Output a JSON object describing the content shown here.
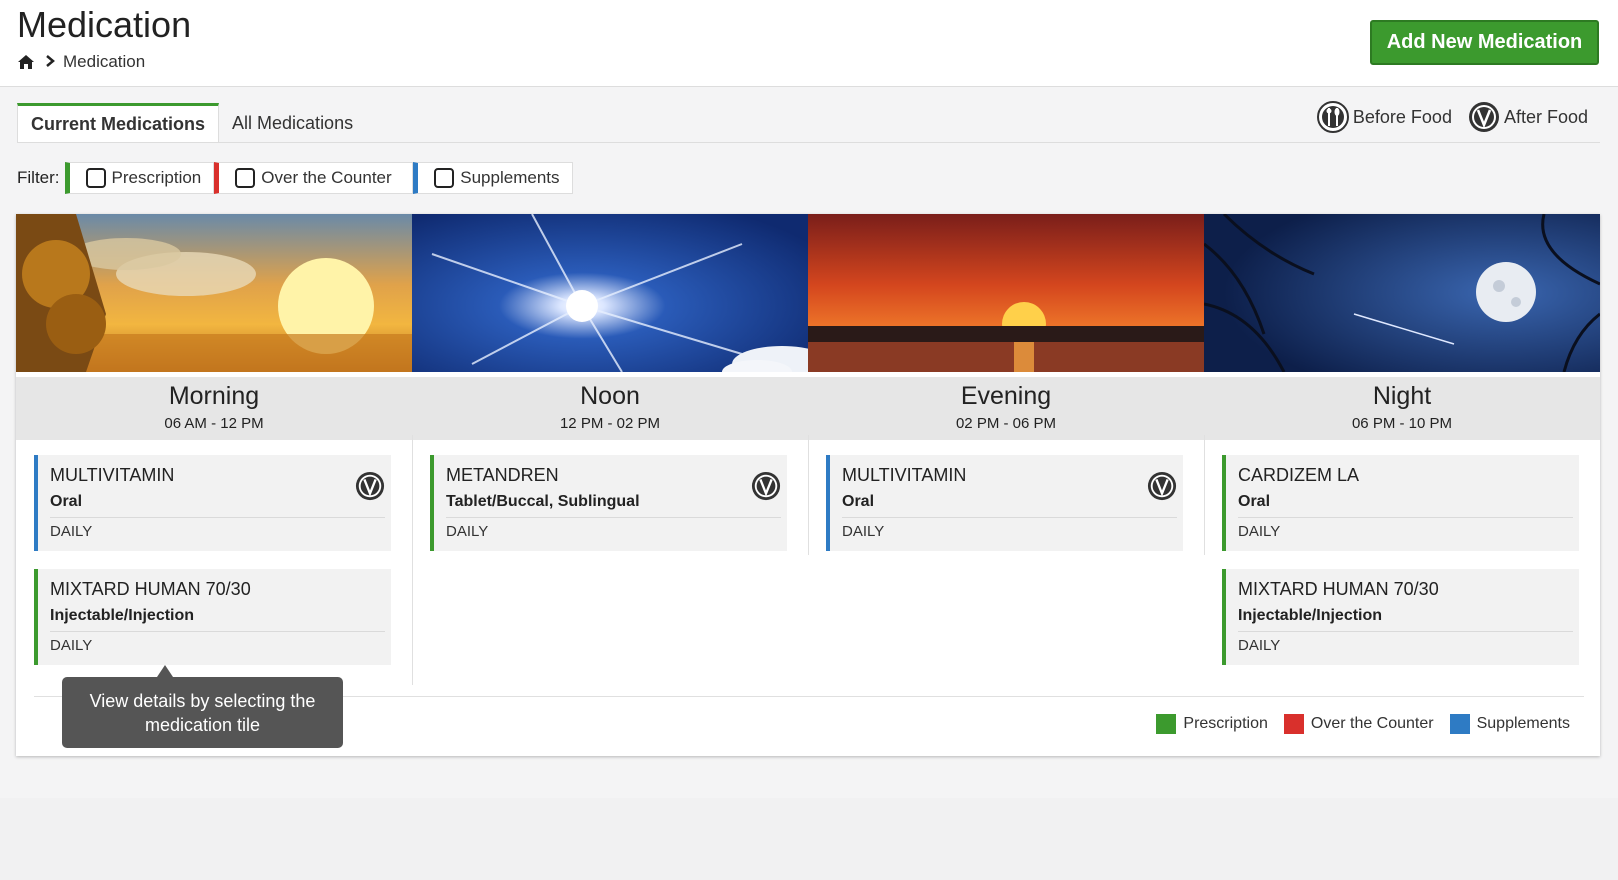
{
  "header": {
    "title": "Medication",
    "breadcrumb_current": "Medication",
    "add_button": "Add New Medication"
  },
  "tabs": [
    {
      "label": "Current Medications",
      "active": true
    },
    {
      "label": "All Medications",
      "active": false
    }
  ],
  "food_legend": {
    "before": "Before Food",
    "after": "After Food"
  },
  "filter": {
    "label": "Filter:",
    "options": [
      {
        "label": "Prescription",
        "color": "#3c9a2e",
        "checked": false
      },
      {
        "label": "Over the Counter",
        "color": "#d9302c",
        "checked": false
      },
      {
        "label": "Supplements",
        "color": "#2e7bc4",
        "checked": false
      }
    ]
  },
  "columns": [
    {
      "period": "Morning",
      "range": "06 AM - 12 PM",
      "cards": [
        {
          "name": "MULTIVITAMIN",
          "route": "Oral",
          "freq": "DAILY",
          "type": "Supplements",
          "food_icon": "food-icon"
        },
        {
          "name": "MIXTARD HUMAN 70/30",
          "route": "Injectable/Injection",
          "freq": "DAILY",
          "type": "Prescription"
        }
      ]
    },
    {
      "period": "Noon",
      "range": "12 PM - 02 PM",
      "cards": [
        {
          "name": "METANDREN",
          "route": "Tablet/Buccal, Sublingual",
          "freq": "DAILY",
          "type": "Prescription",
          "food_icon": "food-icon"
        }
      ]
    },
    {
      "period": "Evening",
      "range": "02 PM - 06 PM",
      "cards": [
        {
          "name": "MULTIVITAMIN",
          "route": "Oral",
          "freq": "DAILY",
          "type": "Supplements",
          "food_icon": "food-icon"
        }
      ]
    },
    {
      "period": "Night",
      "range": "06 PM - 10 PM",
      "cards": [
        {
          "name": "CARDIZEM LA",
          "route": "Oral",
          "freq": "DAILY",
          "type": "Prescription"
        },
        {
          "name": "MIXTARD HUMAN 70/30",
          "route": "Injectable/Injection",
          "freq": "DAILY",
          "type": "Prescription"
        }
      ]
    }
  ],
  "type_legend": [
    {
      "label": "Prescription",
      "color": "#3c9a2e"
    },
    {
      "label": "Over the Counter",
      "color": "#d9302c"
    },
    {
      "label": "Supplements",
      "color": "#2e7bc4"
    }
  ],
  "tooltip": {
    "line1": "View details by selecting the",
    "line2": "medication tile"
  }
}
